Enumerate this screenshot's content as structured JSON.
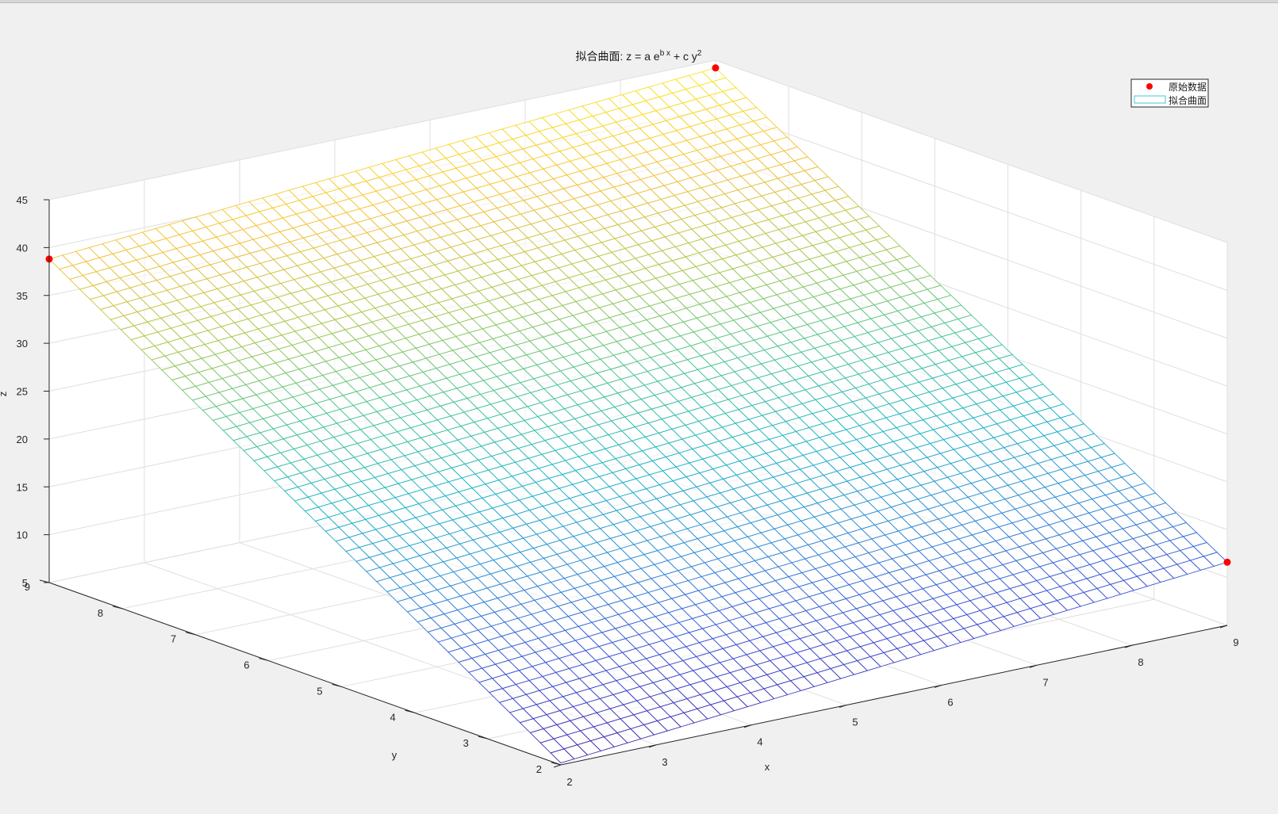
{
  "chart_data": {
    "type": "surface",
    "title_prefix": "拟合曲面: z = a e",
    "title_exp1": "b x",
    "title_mid": " + c y",
    "title_exp2": "2",
    "xlabel": "x",
    "ylabel": "y",
    "zlabel": "z",
    "xlim": [
      2,
      9
    ],
    "ylim": [
      2,
      9
    ],
    "zlim": [
      5,
      45
    ],
    "xticks": [
      2,
      3,
      4,
      5,
      6,
      7,
      8,
      9
    ],
    "yticks": [
      2,
      3,
      4,
      5,
      6,
      7,
      8,
      9
    ],
    "zticks": [
      5,
      10,
      15,
      20,
      25,
      30,
      35,
      40,
      45
    ],
    "grid": true,
    "legend_position": "top-right",
    "legend": [
      {
        "label": "原始数据",
        "kind": "marker",
        "color": "#ff0000"
      },
      {
        "label": "拟合曲面",
        "kind": "surface",
        "color": "#3fc7e0"
      }
    ],
    "colormap": [
      "#3d26a8",
      "#3b4fd6",
      "#2f8ad9",
      "#1bb5c5",
      "#49c493",
      "#a8c74b",
      "#f3c13a",
      "#f9e620"
    ],
    "surface_corners": [
      {
        "x": 2,
        "y": 2,
        "z": 5.2
      },
      {
        "x": 9,
        "y": 2,
        "z": 11.6
      },
      {
        "x": 2,
        "y": 9,
        "z": 38.8
      },
      {
        "x": 9,
        "y": 9,
        "z": 44.2
      }
    ],
    "points": [
      {
        "x": 9,
        "y": 2,
        "z": 11.6
      },
      {
        "x": 2,
        "y": 9,
        "z": 38.8
      },
      {
        "x": 9,
        "y": 9,
        "z": 44.2
      }
    ]
  }
}
